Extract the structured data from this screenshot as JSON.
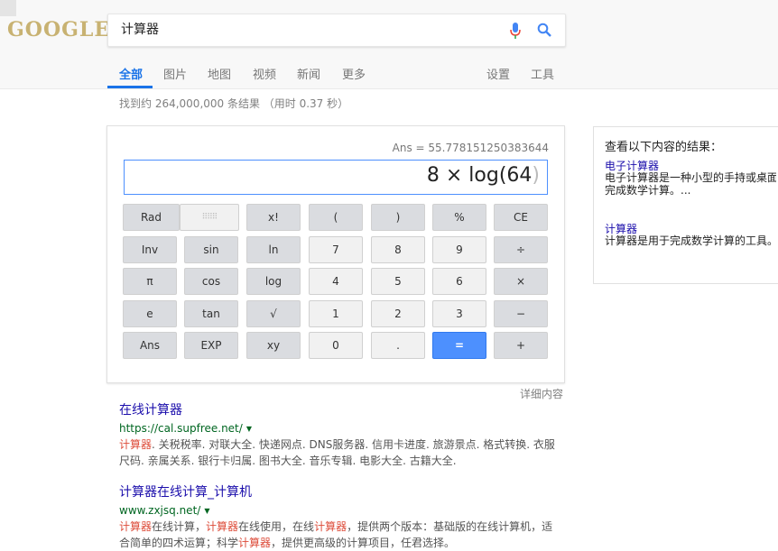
{
  "header": {
    "logo": "GOOGLE",
    "query": "计算器",
    "tabs": [
      "全部",
      "图片",
      "地图",
      "视频",
      "新闻",
      "更多"
    ],
    "tools": [
      "设置",
      "工具"
    ]
  },
  "stats": "找到约 264,000,000 条结果 （用时 0.37 秒）",
  "calculator": {
    "ans": "Ans = 55.778151250383644",
    "expression": "8 × log(64",
    "closing_paren": ")",
    "keys": [
      [
        "Rad",
        "⠿⠿⠿",
        "x!",
        "(",
        ")",
        "%",
        "CE"
      ],
      [
        "Inv",
        "sin",
        "ln",
        "7",
        "8",
        "9",
        "÷"
      ],
      [
        "π",
        "cos",
        "log",
        "4",
        "5",
        "6",
        "×"
      ],
      [
        "e",
        "tan",
        "√",
        "1",
        "2",
        "3",
        "−"
      ],
      [
        "Ans",
        "EXP",
        "xy",
        "0",
        ".",
        "=",
        "+"
      ]
    ],
    "detail_link": "详细内容"
  },
  "results": [
    {
      "title": "在线计算器",
      "url": "https://cal.supfree.net/",
      "snippet_hl": "计算器",
      "snippet_rest": ". 关税税率. 对联大全. 快递网点. DNS服务器. 信用卡进度. 旅游景点. 格式转换. 衣服尺码. 亲属关系. 银行卡归属. 图书大全. 音乐专辑. 电影大全. 古籍大全."
    },
    {
      "title": "计算器在线计算_计算机",
      "url": "www.zxjsq.net/",
      "snippet_hl1": "计算器",
      "snippet_t1": "在线计算，",
      "snippet_hl2": "计算器",
      "snippet_t2": "在线使用，在线",
      "snippet_hl3": "计算器",
      "snippet_t3": "，提供两个版本：基础版的在线计算机，适合简单的四术运算；科学",
      "snippet_hl4": "计算器",
      "snippet_t4": "，提供更高级的计算项目，任君选择。"
    }
  ],
  "sidebar": {
    "heading": "查看以下内容的结果：",
    "items": [
      {
        "title": "电子计算器",
        "desc1": "电子计算器是一种小型的手持或桌面",
        "desc2": "完成数学计算。..."
      },
      {
        "title": "计算器",
        "desc1": "计算器是用于完成数学计算的工具。"
      }
    ]
  },
  "colors": {
    "accent": "#1a73e8",
    "equals": "#4d90fe",
    "link": "#1a0dab",
    "url": "#006621",
    "highlight": "#dd4b39"
  }
}
